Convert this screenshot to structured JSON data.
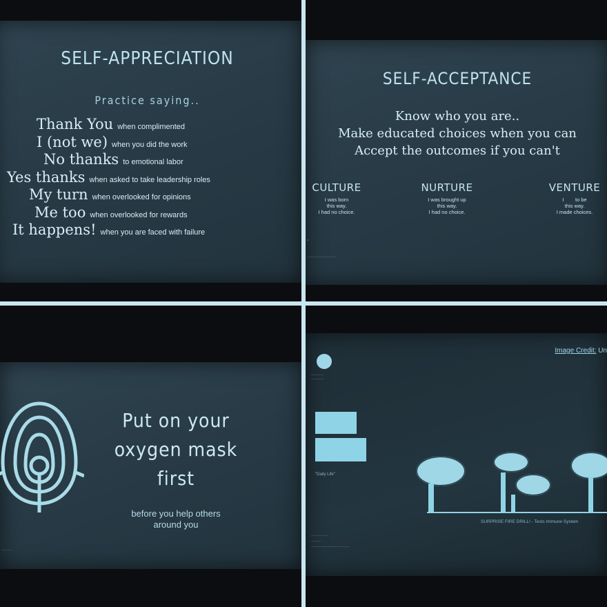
{
  "slide1": {
    "title": "SELF-APPRECIATION",
    "subtitle": "Practice saying..",
    "rows": [
      {
        "phrase": "Thank You",
        "context": "when complimented"
      },
      {
        "phrase": "I (not we)",
        "context": "when you did the work"
      },
      {
        "phrase": "No thanks",
        "context": "to emotional labor"
      },
      {
        "phrase": "Yes thanks",
        "context": "when asked to take leadership roles"
      },
      {
        "phrase": "My turn",
        "context": "when overlooked for opinions"
      },
      {
        "phrase": "Me too",
        "context": "when overlooked for rewards"
      },
      {
        "phrase": "It happens!",
        "context": "when you are faced with failure"
      }
    ]
  },
  "slide2": {
    "title": "SELF-ACCEPTANCE",
    "lines": [
      "Know who you are..",
      "Make educated choices when you can",
      "Accept the outcomes if you can't"
    ],
    "columns": [
      {
        "heading": "CULTURE",
        "text": [
          "I was born",
          "this way.",
          "I had no choice."
        ]
      },
      {
        "heading": "NURTURE",
        "text": [
          "I was brought up",
          "this way.",
          "I had no choice."
        ]
      },
      {
        "heading": "VENTURE",
        "text": [
          "I        to be",
          "this way.",
          "I made choices."
        ]
      }
    ]
  },
  "slide3": {
    "headline": [
      "Put on your",
      "oxygen mask",
      "first"
    ],
    "caption": [
      "before you help others",
      "around you"
    ],
    "icon": "oxygen-mask-icon"
  },
  "slide4": {
    "credit_link": "Image Credit:",
    "credit_rest": "Un",
    "label": "\"Daily Life\"",
    "footer": "SURPRISE FIRE DRILL! - Tests Immune System",
    "colors": {
      "accent": "#8fd4e6"
    }
  },
  "colors": {
    "divider": "#c9e6ef",
    "slide_bg": "#2b3e49",
    "text": "#cde9f1"
  }
}
